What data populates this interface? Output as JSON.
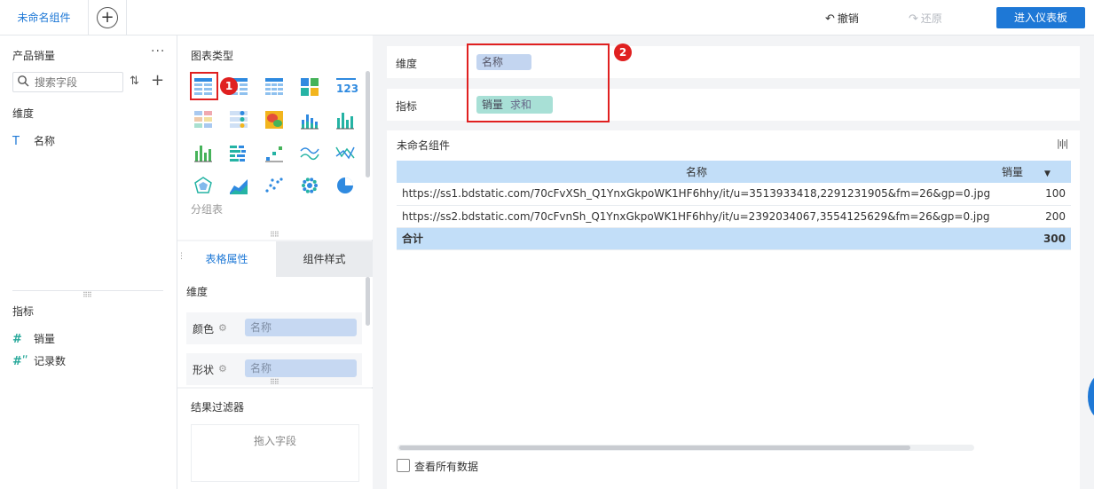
{
  "topbar": {
    "tab_label": "未命名组件",
    "add_tab_symbol": "+",
    "undo_label": "撤销",
    "redo_label": "还原",
    "enter_dashboard_label": "进入仪表板"
  },
  "left_panel": {
    "dataset_name": "产品销量",
    "more_symbol": "···",
    "search_placeholder": "搜索字段",
    "dimension_header": "维度",
    "dimension_fields": [
      "名称"
    ],
    "measure_header": "指标",
    "measure_fields": [
      "销量",
      "记录数"
    ]
  },
  "chart_panel": {
    "title": "图表类型",
    "group_label": "分组表",
    "selected_index": 0,
    "annotation_1": "1",
    "icon_names": [
      "table-chart-icon",
      "cross-table-icon",
      "detail-table-icon",
      "treemap-icon",
      "kpi-number-icon",
      "colored-table-icon",
      "scatter-table-icon",
      "heatmap-icon",
      "stacked-bar-icon",
      "bar-chart-icon",
      "column-chart-icon",
      "grouped-bar-icon",
      "stepped-bar-icon",
      "multi-line-icon",
      "line-chart-icon",
      "radar-chart-icon",
      "area-chart-icon",
      "scatter-chart-icon",
      "dot-ring-icon",
      "pie-chart-icon"
    ]
  },
  "properties": {
    "tab_table": "表格属性",
    "tab_style": "组件样式",
    "dimension_label": "维度",
    "color_label": "颜色",
    "color_field": "名称",
    "shape_label": "形状",
    "shape_field": "名称",
    "filter_title": "结果过滤器",
    "filter_drop_hint": "拖入字段"
  },
  "config": {
    "dimension_label": "维度",
    "dimension_pill": "名称",
    "measure_label": "指标",
    "measure_pill": "销量",
    "measure_agg": "求和",
    "annotation_2": "2"
  },
  "widget": {
    "title": "未命名组件",
    "columns": [
      "名称",
      "销量"
    ],
    "rows": [
      {
        "name": "https://ss1.bdstatic.com/70cFvXSh_Q1YnxGkpoWK1HF6hhy/it/u=3513933418,2291231905&fm=26&gp=0.jpg",
        "value": "100"
      },
      {
        "name": "https://ss2.bdstatic.com/70cFvnSh_Q1YnxGkpoWK1HF6hhy/it/u=2392034067,3554125629&fm=26&gp=0.jpg",
        "value": "200"
      }
    ],
    "total_label": "合计",
    "total_value": "300",
    "show_all_label": "查看所有数据"
  },
  "colors": {
    "accent": "#1e78d6",
    "annotation_red": "#e02020",
    "dimension_pill": "#c3d5f0",
    "measure_pill": "#a8e0d6",
    "table_header": "#c2def8"
  }
}
